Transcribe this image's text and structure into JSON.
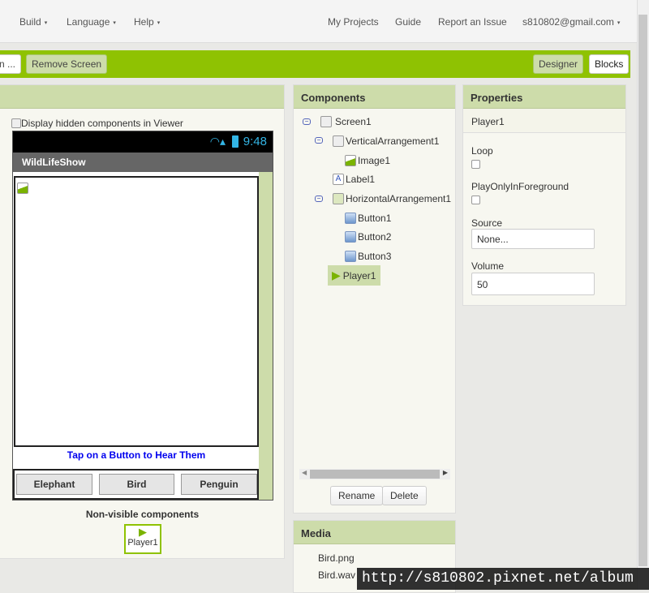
{
  "nav": {
    "build": "Build",
    "language": "Language",
    "help": "Help",
    "my_projects": "My Projects",
    "guide": "Guide",
    "report": "Report an Issue",
    "account": "s810802@gmail.com",
    "caret": "▾"
  },
  "toolbar": {
    "add_screen": "n ...",
    "remove_screen": "Remove Screen",
    "designer": "Designer",
    "blocks": "Blocks"
  },
  "viewer": {
    "hidden_label": "Display hidden components in Viewer",
    "time": "9:48",
    "app_title": "WildLifeShow",
    "label_text": "Tap on a Button to Hear Them",
    "buttons": [
      "Elephant",
      "Bird",
      "Penguin"
    ],
    "nonvisible_title": "Non-visible components",
    "nonvisible_item": "Player1"
  },
  "components": {
    "title": "Components",
    "tree": [
      "Screen1",
      "VerticalArrangement1",
      "Image1",
      "Label1",
      "HorizontalArrangement1",
      "Button1",
      "Button2",
      "Button3",
      "Player1"
    ],
    "rename": "Rename",
    "delete": "Delete"
  },
  "media": {
    "title": "Media",
    "files": [
      "Bird.png",
      "Bird.wav"
    ]
  },
  "properties": {
    "title": "Properties",
    "component": "Player1",
    "loop": "Loop",
    "play_fg": "PlayOnlyInForeground",
    "source": "Source",
    "source_value": "None...",
    "volume": "Volume",
    "volume_value": "50"
  },
  "watermark": "http://s810802.pixnet.net/album",
  "colors": {
    "toolbar": "#8fc202",
    "header": "#cddcaa",
    "label": "#0000ee"
  }
}
